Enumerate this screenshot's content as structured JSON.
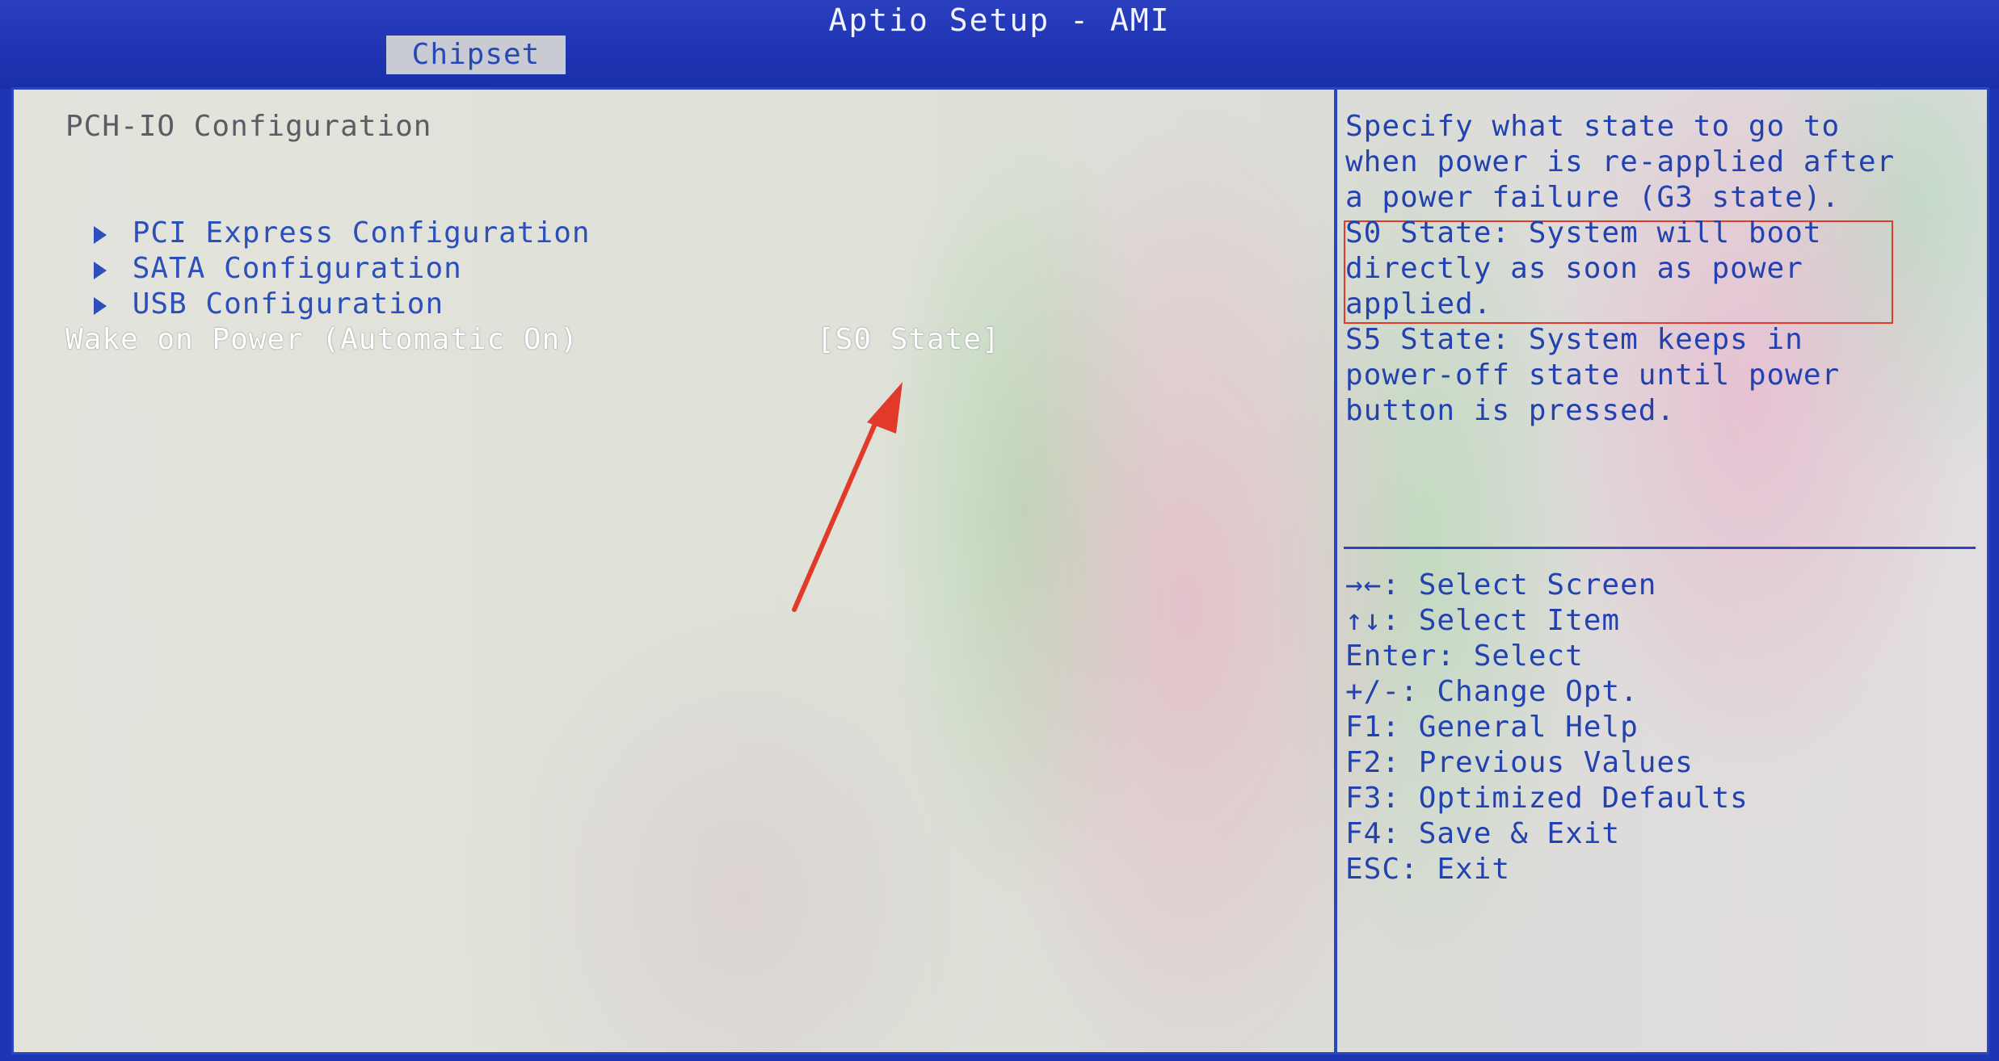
{
  "window": {
    "title": "Aptio Setup - AMI"
  },
  "tabs": [
    {
      "label": "Chipset",
      "selected": true
    }
  ],
  "main": {
    "section_title": "PCH-IO Configuration",
    "submenus": [
      {
        "label": "PCI Express Configuration"
      },
      {
        "label": "SATA Configuration"
      },
      {
        "label": "USB Configuration"
      }
    ],
    "setting": {
      "label": "Wake on Power (Automatic On)",
      "value": "[S0 State]"
    }
  },
  "help": {
    "lines": [
      "Specify what state to go to",
      "when power is re-applied after",
      "a power failure (G3 state).",
      "S0 State: System will boot",
      "directly as soon as power",
      "applied.",
      "S5 State: System keeps in",
      "power-off state until power",
      "button is pressed."
    ]
  },
  "keys": {
    "lines": [
      "→←: Select Screen",
      "↑↓: Select Item",
      "Enter: Select",
      "+/-: Change Opt.",
      "F1: General Help",
      "F2: Previous Values",
      "F3: Optimized Defaults",
      "F4: Save & Exit",
      "ESC: Exit"
    ]
  },
  "colors": {
    "frame_blue": "#1d37b4",
    "text_blue": "#2342b0",
    "annotation_red": "#e23a2a",
    "selected_text": "#ffffff"
  },
  "icons": {
    "submenu_marker": "triangle-right-icon",
    "annotation": "red-arrow-icon"
  }
}
